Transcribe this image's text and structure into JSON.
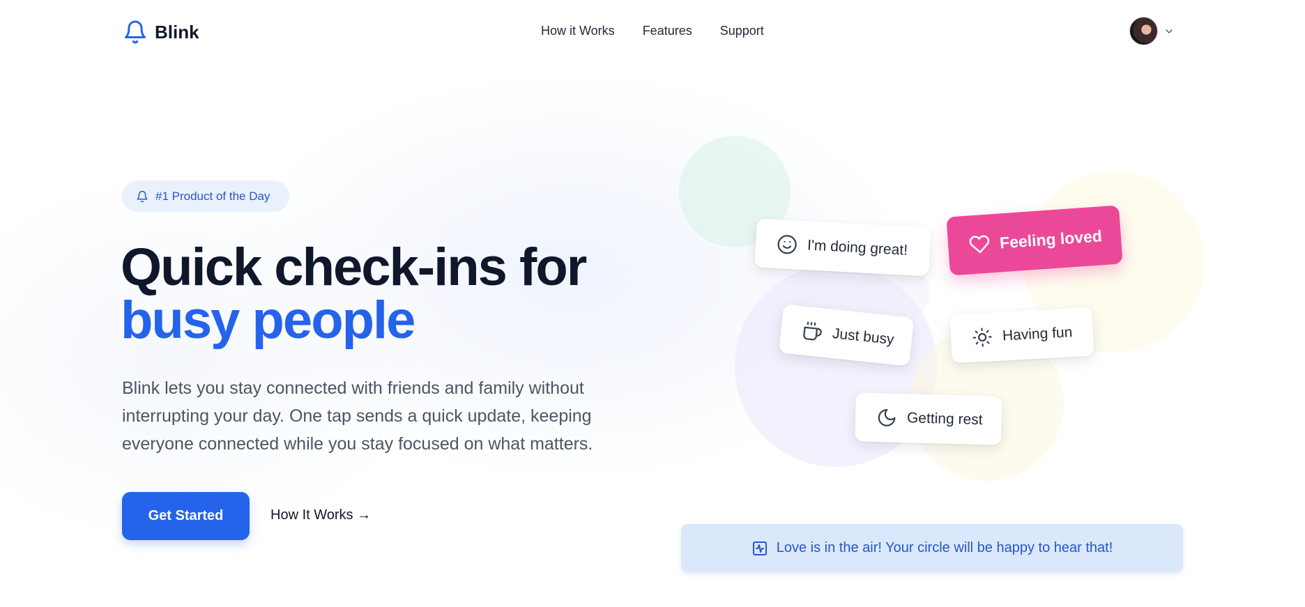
{
  "header": {
    "brand": "Blink",
    "nav": [
      "How it Works",
      "Features",
      "Support"
    ]
  },
  "hero": {
    "badge": "#1 Product of the Day",
    "headline_line1": "Quick check-ins for",
    "headline_line2": "busy people",
    "description": "Blink lets you stay connected with friends and family without interrupting your day. One tap sends a quick update, keeping everyone connected while you stay focused on what matters.",
    "primary_cta": "Get Started",
    "secondary_link": "How It Works →"
  },
  "status_cards": [
    {
      "label": "I'm doing great!",
      "icon": "smile-icon"
    },
    {
      "label": "Feeling loved",
      "icon": "heart-icon"
    },
    {
      "label": "Just busy",
      "icon": "coffee-icon"
    },
    {
      "label": "Having fun",
      "icon": "sun-icon"
    },
    {
      "label": "Getting rest",
      "icon": "moon-icon"
    }
  ],
  "banner": {
    "text": "Love is in the air! Your circle will be happy to hear that!",
    "icon": "activity-icon"
  },
  "colors": {
    "primary": "#2563eb",
    "heading": "#0f172a",
    "loved": "#ec4899",
    "banner_bg": "#dbe8fb"
  }
}
